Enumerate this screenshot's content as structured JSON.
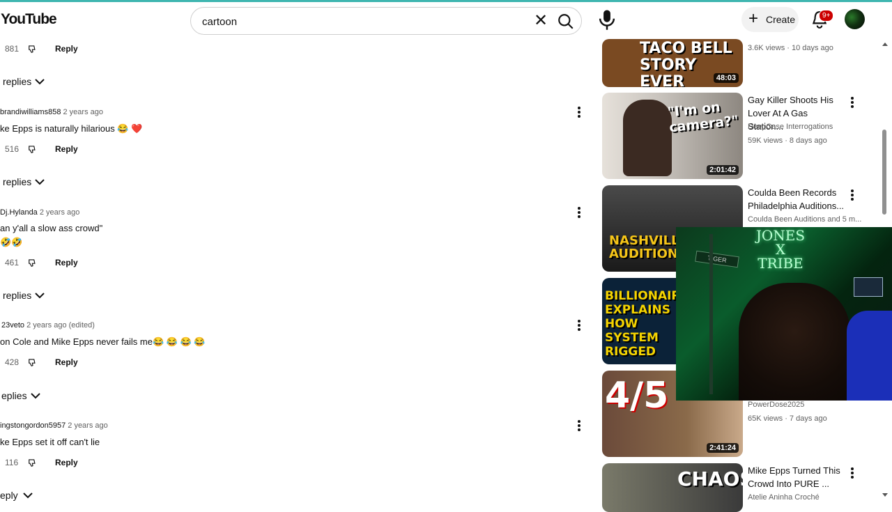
{
  "header": {
    "logo": "YouTube",
    "search_value": "cartoon",
    "create_label": "Create",
    "notifications_badge": "9+"
  },
  "comments": [
    {
      "likes": "881",
      "reply_label": "Reply",
      "replies_label": "replies"
    },
    {
      "author": "brandiwilliams858",
      "time": "2 years ago",
      "text": "ke Epps is naturally hilarious 😂 ❤️",
      "likes": "516",
      "reply_label": "Reply",
      "replies_label": "replies"
    },
    {
      "author": "Dj.Hylanda",
      "time": "2 years ago",
      "text": "an y'all a slow ass crowd\"",
      "text2": "🤣🤣",
      "likes": "461",
      "reply_label": "Reply",
      "replies_label": "replies"
    },
    {
      "author": "23veto",
      "time": "2 years ago (edited)",
      "text": "on Cole and Mike Epps never fails me😂 😂 😂 😂",
      "likes": "428",
      "reply_label": "Reply",
      "replies_label": "eplies"
    },
    {
      "author": "ingstongordon5957",
      "time": "2 years ago",
      "text": "ke Epps set it off can't lie",
      "likes": "116",
      "reply_label": "Reply",
      "replies_label": "eply"
    }
  ],
  "videos": [
    {
      "thumb_text": "TACO BELL STORY EVER",
      "duration": "48:03",
      "meta": "3.6K views · 10 days ago",
      "thumb_bg": "#7a4a22"
    },
    {
      "thumb_text": "\"I'm on camera?\"",
      "duration": "2:01:42",
      "title": "Gay Killer Shoots His Lover At A Gas Station...",
      "channel": "DeepCase Interrogations",
      "meta": "59K views · 8 days ago",
      "thumb_bg": "#c7c2bc"
    },
    {
      "thumb_text": "NASHVILLE AUDITIONS",
      "title": "Coulda Been Records Philadelphia Auditions...",
      "channel": "Coulda Been Auditions and 5 m...",
      "thumb_bg": "#2b2b2b"
    },
    {
      "thumb_text": "BILLIONAIRE EXPLAINS HOW SYSTEM RIGGED",
      "thumb_bg": "#0b2238"
    },
    {
      "thumb_text": "4/5",
      "duration": "2:41:24",
      "channel": "PowerDose2025",
      "meta": "65K views · 7 days ago",
      "thumb_bg": "#6b4a3a"
    },
    {
      "thumb_text": "CHAOS",
      "title": "Mike Epps Turned This Crowd Into PURE ...",
      "channel": "Atelie Aninha Croché",
      "thumb_bg": "#3a3a3a"
    }
  ],
  "overlay": {
    "neon_text_1": "JONES",
    "neon_text_2": "X",
    "neon_text_3": "TRIBE",
    "sign_text": "TIGER"
  },
  "colors": {
    "accent_red": "#cc0000",
    "top_line": "#3fb6b0"
  }
}
